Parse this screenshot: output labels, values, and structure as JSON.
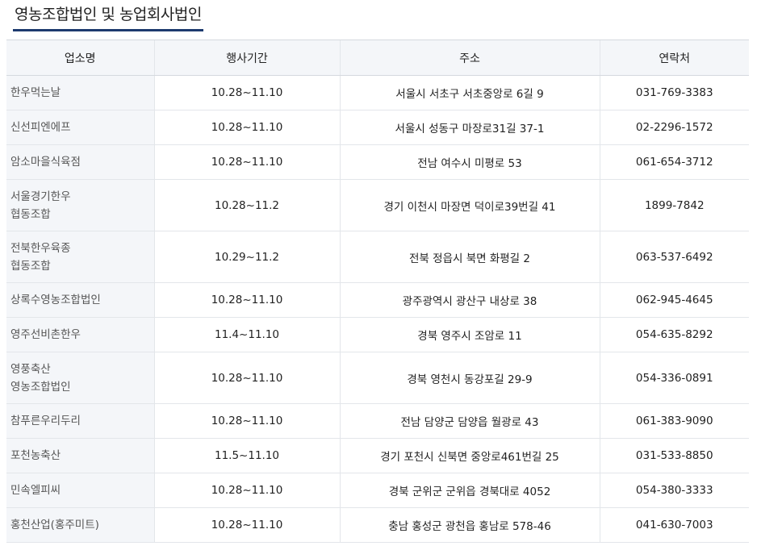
{
  "page": {
    "title": "영농조합법인 및 농업회사법인"
  },
  "table": {
    "headers": [
      "업소명",
      "행사기간",
      "주소",
      "연락처"
    ],
    "rows": [
      {
        "name": [
          "한우먹는날"
        ],
        "period": "10.28~11.10",
        "address": "서울시 서초구 서초중앙로 6길 9",
        "phone": "031-769-3383"
      },
      {
        "name": [
          "신선피엔에프"
        ],
        "period": "10.28~11.10",
        "address": "서울시 성동구 마장로31길 37-1",
        "phone": "02-2296-1572"
      },
      {
        "name": [
          "암소마을식육점"
        ],
        "period": "10.28~11.10",
        "address": "전남 여수시 미평로 53",
        "phone": "061-654-3712"
      },
      {
        "name": [
          "서울경기한우",
          "협동조합"
        ],
        "period": "10.28~11.2",
        "address": "경기 이천시 마장면 덕이로39번길 41",
        "phone": "1899-7842"
      },
      {
        "name": [
          "전북한우육종",
          "협동조합"
        ],
        "period": "10.29~11.2",
        "address": "전북 정읍시 북면 화평길 2",
        "phone": "063-537-6492"
      },
      {
        "name": [
          "상록수영농조합법인"
        ],
        "period": "10.28~11.10",
        "address": "광주광역시 광산구 내상로 38",
        "phone": "062-945-4645"
      },
      {
        "name": [
          "영주선비촌한우"
        ],
        "period": "11.4~11.10",
        "address": "경북 영주시 조암로 11",
        "phone": "054-635-8292"
      },
      {
        "name": [
          "영풍축산",
          "영농조합법인"
        ],
        "period": "10.28~11.10",
        "address": "경북 영천시 동강포길 29-9",
        "phone": "054-336-0891"
      },
      {
        "name": [
          "참푸른우리두리"
        ],
        "period": "10.28~11.10",
        "address": "전남 담양군 담양읍 월광로 43",
        "phone": "061-383-9090"
      },
      {
        "name": [
          "포천농축산"
        ],
        "period": "11.5~11.10",
        "address": "경기 포천시 신북면 중앙로461번길 25",
        "phone": "031-533-8850"
      },
      {
        "name": [
          "민속엘피씨"
        ],
        "period": "10.28~11.10",
        "address": "경북 군위군 군위읍 경북대로 4052",
        "phone": "054-380-3333"
      },
      {
        "name": [
          "홍천산업(홍주미트)"
        ],
        "period": "10.28~11.10",
        "address": "충남 홍성군 광천읍 홍남로 578-46",
        "phone": "041-630-7003"
      }
    ]
  }
}
